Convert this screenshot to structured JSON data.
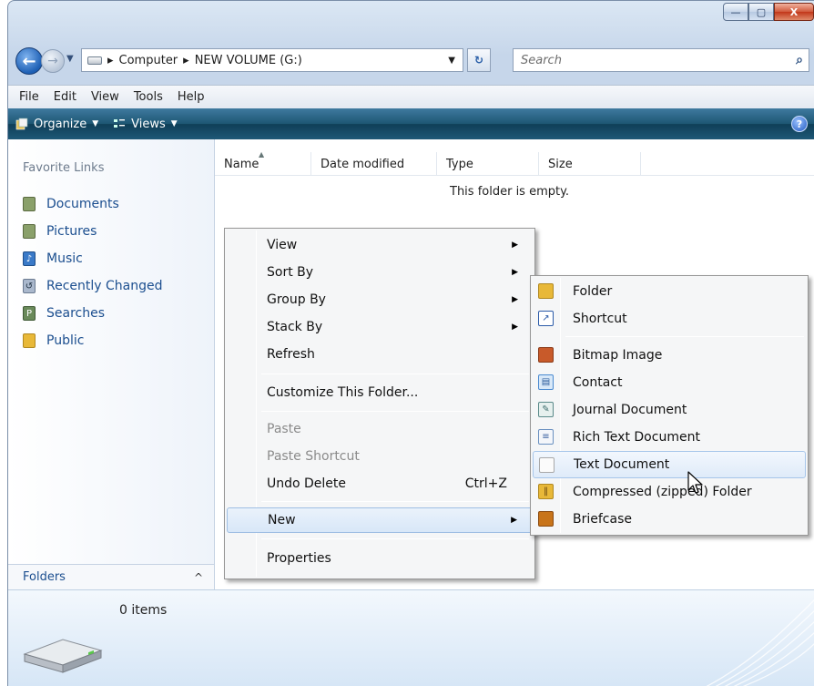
{
  "window": {
    "controls": {
      "minimize": "—",
      "maximize": "▢",
      "close": "X"
    }
  },
  "navigation": {
    "back_glyph": "←",
    "forward_glyph": "→",
    "dropdown_glyph": "▼",
    "address": {
      "crumbs": [
        "Computer",
        "NEW VOLUME (G:)"
      ],
      "separator": "▸"
    },
    "refresh_glyph": "↻",
    "search_placeholder": "Search"
  },
  "menubar": [
    "File",
    "Edit",
    "View",
    "Tools",
    "Help"
  ],
  "toolbar": {
    "organize": "Organize",
    "views": "Views",
    "help": "?"
  },
  "sidebar": {
    "title": "Favorite Links",
    "items": [
      {
        "label": "Documents",
        "icon": "documents-icon",
        "color": "#8aa06a"
      },
      {
        "label": "Pictures",
        "icon": "pictures-icon",
        "color": "#8aa06a"
      },
      {
        "label": "Music",
        "icon": "music-icon",
        "color": "#3a7ac8"
      },
      {
        "label": "Recently Changed",
        "icon": "recent-icon",
        "color": "#7a8fb0"
      },
      {
        "label": "Searches",
        "icon": "searches-icon",
        "color": "#6a8a5a"
      },
      {
        "label": "Public",
        "icon": "public-folder-icon",
        "color": "#e8b838"
      }
    ],
    "folders_label": "Folders",
    "folders_caret": "^"
  },
  "columns": [
    "Name",
    "Date modified",
    "Type",
    "Size"
  ],
  "empty_message": "This folder is empty.",
  "details": {
    "count": "0 items"
  },
  "context_menu": {
    "items": [
      {
        "label": "View",
        "submenu": true
      },
      {
        "label": "Sort By",
        "submenu": true
      },
      {
        "label": "Group By",
        "submenu": true
      },
      {
        "label": "Stack By",
        "submenu": true
      },
      {
        "label": "Refresh"
      },
      {
        "label": "Customize This Folder..."
      },
      {
        "label": "Paste",
        "disabled": true
      },
      {
        "label": "Paste Shortcut",
        "disabled": true
      },
      {
        "label": "Undo Delete",
        "accel": "Ctrl+Z"
      },
      {
        "label": "New",
        "submenu": true,
        "highlighted": true
      },
      {
        "label": "Properties"
      }
    ]
  },
  "new_submenu": {
    "items": [
      {
        "label": "Folder",
        "icon": "folder-icon",
        "color": "#e8b838"
      },
      {
        "label": "Shortcut",
        "icon": "shortcut-icon",
        "color": "#2b5aa8"
      },
      {
        "label": "Bitmap Image",
        "icon": "bitmap-icon",
        "color": "#c85a2a"
      },
      {
        "label": "Contact",
        "icon": "contact-icon",
        "color": "#4a8ad0"
      },
      {
        "label": "Journal Document",
        "icon": "journal-icon",
        "color": "#5a8a8a"
      },
      {
        "label": "Rich Text Document",
        "icon": "rtf-icon",
        "color": "#6a90c0"
      },
      {
        "label": "Text Document",
        "icon": "text-document-icon",
        "color": "#d8d8d8",
        "highlighted": true
      },
      {
        "label": "Compressed (zipped) Folder",
        "icon": "zip-folder-icon",
        "color": "#e8b838"
      },
      {
        "label": "Briefcase",
        "icon": "briefcase-icon",
        "color": "#c8741a"
      }
    ]
  }
}
